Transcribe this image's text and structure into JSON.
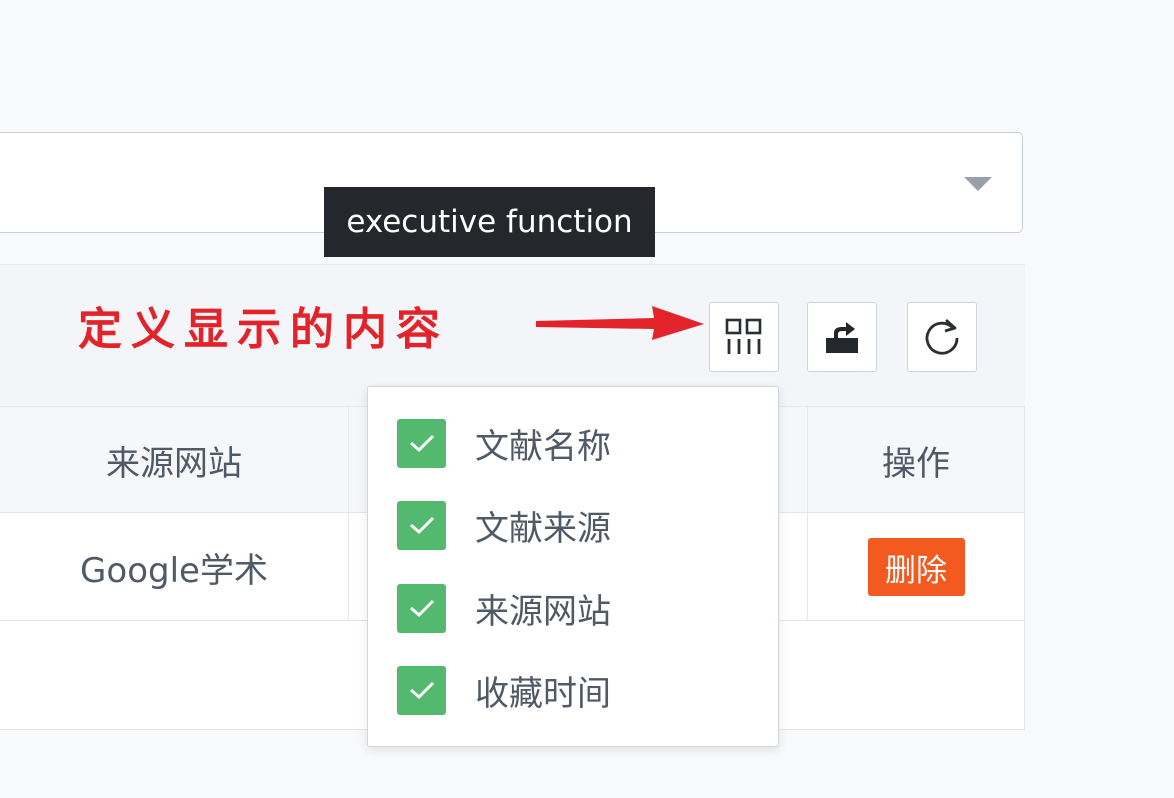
{
  "tooltip": {
    "text": "executive function"
  },
  "annotation": {
    "text": "定义显示的内容"
  },
  "toolbar": {
    "columns_icon": "columns-icon",
    "export_icon": "export-icon",
    "refresh_icon": "refresh-icon"
  },
  "table": {
    "headers": {
      "source_site": "来源网站",
      "actions": "操作"
    },
    "rows": [
      {
        "source_site": "Google学术",
        "delete_label": "删除"
      }
    ]
  },
  "column_menu": {
    "items": [
      {
        "label": "文献名称",
        "checked": true
      },
      {
        "label": "文献来源",
        "checked": true
      },
      {
        "label": "来源网站",
        "checked": true
      },
      {
        "label": "收藏时间",
        "checked": true
      }
    ]
  },
  "colors": {
    "annotation": "#e2242a",
    "checkbox": "#52b96f",
    "delete_button": "#f25a1f",
    "tooltip_bg": "#24272b"
  }
}
